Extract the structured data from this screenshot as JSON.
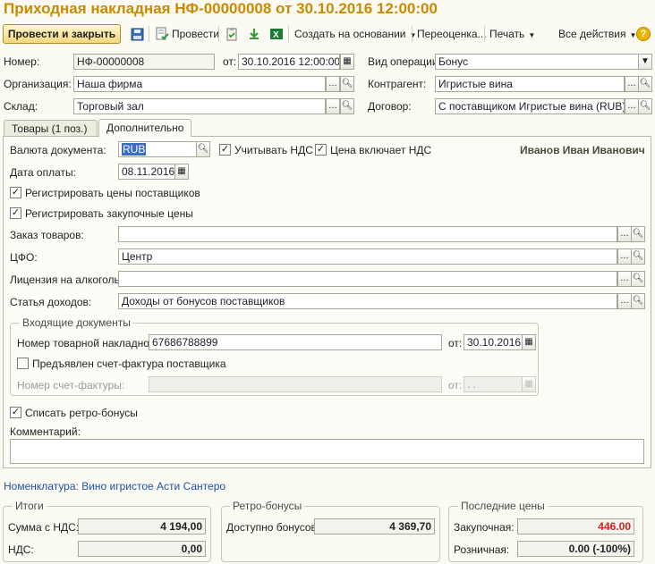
{
  "title": "Приходная накладная НФ-00000008 от 30.10.2016 12:00:00",
  "toolbar": {
    "post_close": "Провести и закрыть",
    "post": "Провести",
    "create_based": "Создать на основании",
    "reprice": "Переоценка...",
    "print": "Печать",
    "all_actions": "Все действия"
  },
  "header": {
    "number_label": "Номер:",
    "number_value": "НФ-00000008",
    "date_label": "от:",
    "date_value": "30.10.2016 12:00:00",
    "op_label": "Вид операции:",
    "op_value": "Бонус",
    "org_label": "Организация:",
    "org_value": "Наша фирма",
    "counterparty_label": "Контрагент:",
    "counterparty_value": "Игристые вина",
    "warehouse_label": "Склад:",
    "warehouse_value": "Торговый зал",
    "contract_label": "Договор:",
    "contract_value": "С поставщиком Игристые вина (RUB), На"
  },
  "tabs": [
    {
      "label": "Товары (1 поз.)"
    },
    {
      "label": "Дополнительно"
    }
  ],
  "extra": {
    "currency_label": "Валюта документа:",
    "currency_value": "RUB",
    "vat_check_label": "Учитывать НДС",
    "vat_included_label": "Цена включает НДС",
    "responsible": "Иванов Иван Иванович",
    "pay_date_label": "Дата оплаты:",
    "pay_date_value": "08.11.2016",
    "reg_supplier_prices": "Регистрировать цены поставщиков",
    "reg_purchase_prices": "Регистрировать закупочные цены",
    "order_label": "Заказ товаров:",
    "order_value": "",
    "cfo_label": "ЦФО:",
    "cfo_value": "Центр",
    "license_label": "Лицензия на алкоголь:",
    "license_value": "",
    "income_item_label": "Статья доходов:",
    "income_item_value": "Доходы от бонусов поставщиков",
    "incoming_docs_title": "Входящие документы",
    "waybill_label": "Номер товарной накладной:",
    "waybill_value": "67686788899",
    "waybill_date_label": "от:",
    "waybill_date_value": "30.10.2016",
    "invoice_presented_label": "Предъявлен счет-фактура поставщика",
    "invoice_number_label": "Номер счет-фактуры:",
    "invoice_number_value": "",
    "invoice_date_label": "от:",
    "invoice_date_value": " .  .",
    "write_off_bonus_label": "Списать ретро-бонусы",
    "comment_label": "Комментарий:",
    "comment_value": ""
  },
  "nomenclature_link": "Номенклатура: Вино игристое Асти Сантеро",
  "totals": {
    "title": "Итоги",
    "sum_label": "Сумма с НДС:",
    "sum_value": "4 194,00",
    "vat_label": "НДС:",
    "vat_value": "0,00"
  },
  "retro": {
    "title": "Ретро-бонусы",
    "available_label": "Доступно бонусов:",
    "available_value": "4 369,70"
  },
  "last_prices": {
    "title": "Последние цены",
    "purchase_label": "Закупочная:",
    "purchase_value": "446.00",
    "retail_label": "Розничная:",
    "retail_value": "0.00 (-100%)"
  },
  "colors": {
    "title": "#c98a00",
    "link": "#1f4fa3",
    "warning_price": "#d42020"
  }
}
